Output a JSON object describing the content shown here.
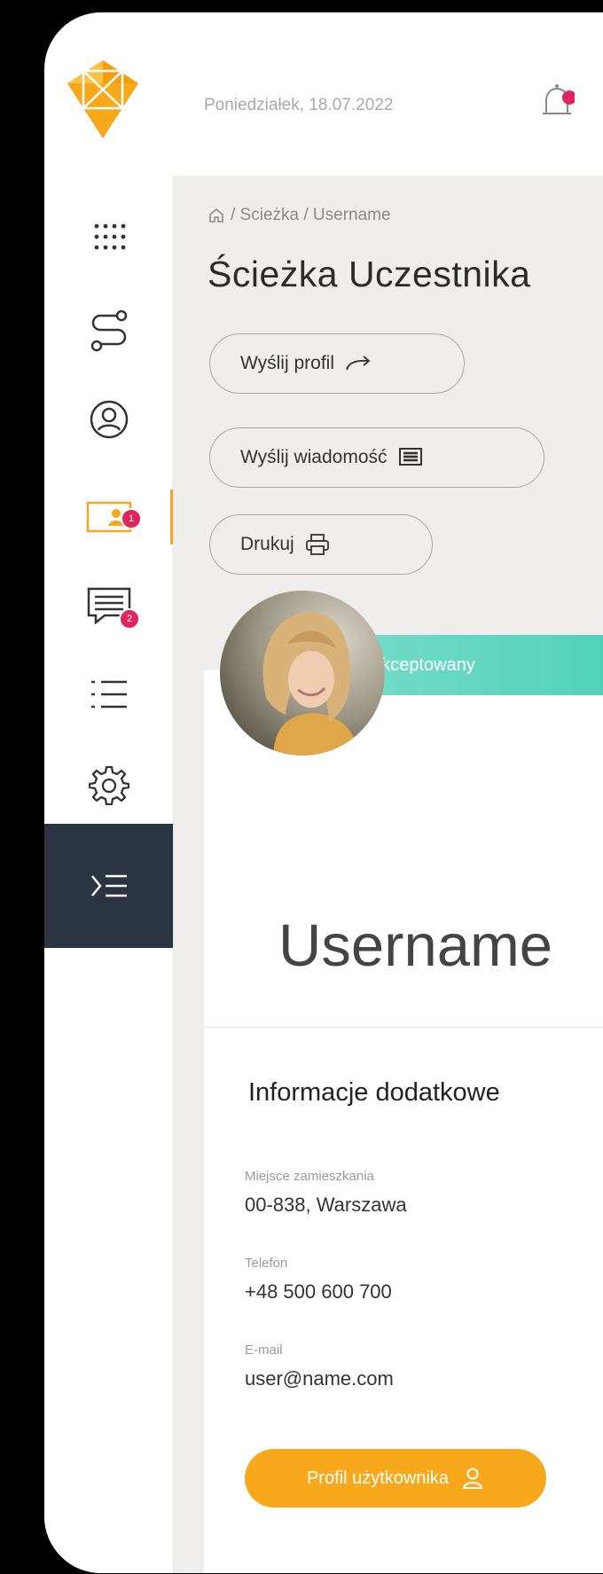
{
  "header": {
    "date": "Poniedziałek, 18.07.2022",
    "logo_icon": "gem-logo-icon",
    "bell_icon": "bell-icon"
  },
  "sidebar": {
    "items": [
      {
        "name": "apps",
        "icon": "grid-dots-icon"
      },
      {
        "name": "path",
        "icon": "route-icon"
      },
      {
        "name": "profile",
        "icon": "user-circle-icon"
      },
      {
        "name": "participants",
        "icon": "id-card-icon",
        "badge": "1",
        "active": true
      },
      {
        "name": "messages",
        "icon": "message-icon",
        "badge": "2"
      },
      {
        "name": "list",
        "icon": "list-icon"
      },
      {
        "name": "settings",
        "icon": "gear-icon"
      },
      {
        "name": "collapse",
        "icon": "collapse-menu-icon"
      }
    ]
  },
  "breadcrumb": {
    "home_icon": "home-icon",
    "text": "/ Scieżka / Username"
  },
  "page": {
    "title": "Ścieżka Uczestnika"
  },
  "actions": {
    "send_profile": "Wyślij profil",
    "send_message": "Wyślij wiadomość",
    "print": "Drukuj"
  },
  "profile": {
    "status": "zaakceptowany",
    "username": "Username"
  },
  "info": {
    "title": "Informacje dodatkowe",
    "residence_label": "Miejsce zamieszkania",
    "residence_value": "00-838, Warszawa",
    "phone_label": "Telefon",
    "phone_value": "+48 500 600 700",
    "email_label": "E-mail",
    "email_value": "user@name.com",
    "profile_button": "Profil użytkownika"
  },
  "colors": {
    "accent": "#f7a81b",
    "badge": "#e0245e",
    "status": "#5fd6bf",
    "dark": "#2b3440",
    "background": "#efeeec"
  }
}
